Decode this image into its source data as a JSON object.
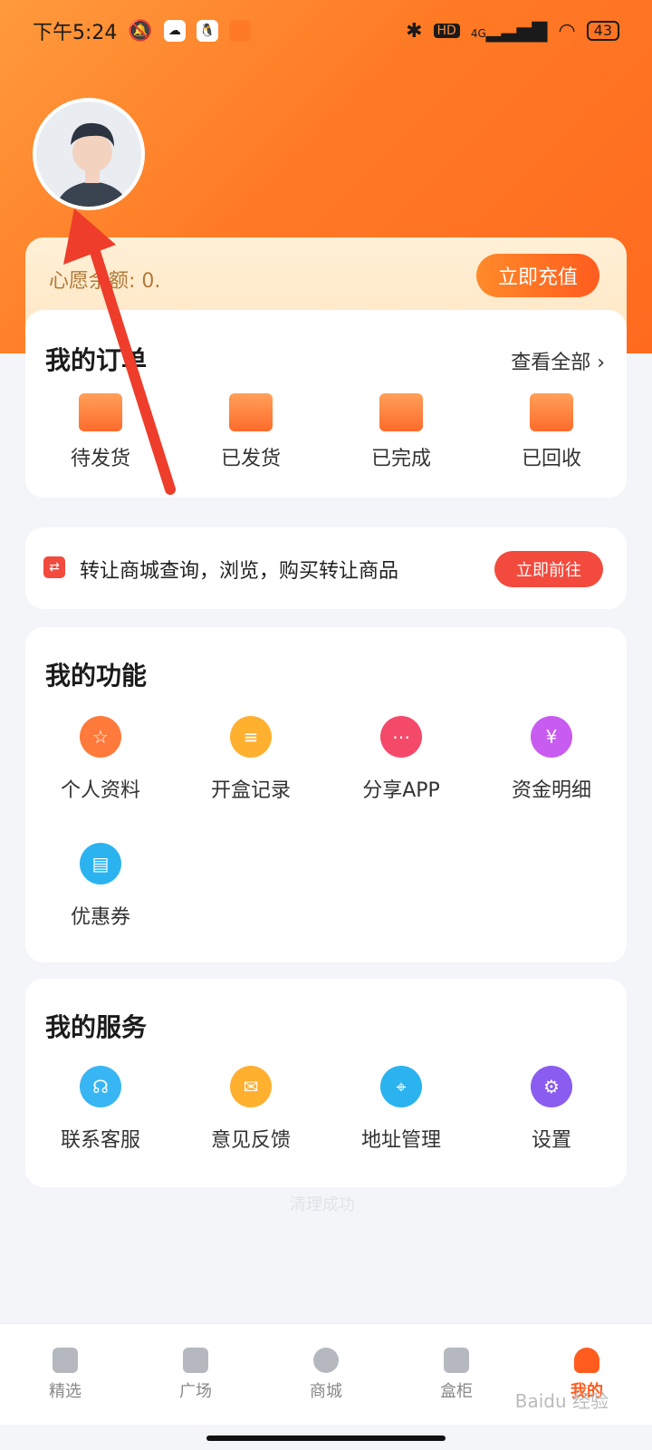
{
  "status_bar": {
    "time": "下午5:24",
    "battery": "43",
    "network": "4G",
    "hd": "HD"
  },
  "wish": {
    "balance_label": "心愿",
    "balance_text": "余额: 0.",
    "recharge_button": "立即充值"
  },
  "orders": {
    "title": "我的订单",
    "view_all": "查看全部 ›",
    "items": [
      {
        "label": "待发货",
        "icon": "box-icon"
      },
      {
        "label": "已发货",
        "icon": "truck-icon"
      },
      {
        "label": "已完成",
        "icon": "basket-icon"
      },
      {
        "label": "已回收",
        "icon": "folder-arrow-icon"
      }
    ]
  },
  "transfer": {
    "text": "转让商城查询，浏览，购买转让商品",
    "button": "立即前往"
  },
  "functions": {
    "title": "我的功能",
    "items": [
      {
        "label": "个人资料",
        "icon": "profile-icon",
        "color": "#ff7a3b"
      },
      {
        "label": "开盒记录",
        "icon": "clipboard-icon",
        "color": "#ffb02e"
      },
      {
        "label": "分享APP",
        "icon": "share-icon",
        "color": "#f5496a"
      },
      {
        "label": "资金明细",
        "icon": "yuan-doc-icon",
        "color": "#c85bf0"
      },
      {
        "label": "优惠券",
        "icon": "coupon-icon",
        "color": "#2ab3ef"
      }
    ]
  },
  "services": {
    "title": "我的服务",
    "items": [
      {
        "label": "联系客服",
        "icon": "headset-icon",
        "color": "#37b6f3"
      },
      {
        "label": "意见反馈",
        "icon": "mail-icon",
        "color": "#ffb02e"
      },
      {
        "label": "地址管理",
        "icon": "location-icon",
        "color": "#2ab3ef"
      },
      {
        "label": "设置",
        "icon": "gear-icon",
        "color": "#8a5cf0"
      }
    ]
  },
  "faint_text": "清理成功",
  "tabbar": {
    "tabs": [
      {
        "label": "精选",
        "icon": "gift-icon",
        "active": false
      },
      {
        "label": "广场",
        "icon": "home-icon",
        "active": false
      },
      {
        "label": "商城",
        "icon": "grid-icon",
        "active": false
      },
      {
        "label": "盒柜",
        "icon": "cabinet-icon",
        "active": false
      },
      {
        "label": "我的",
        "icon": "user-icon",
        "active": true
      }
    ]
  },
  "watermark": "Baidu 经验"
}
